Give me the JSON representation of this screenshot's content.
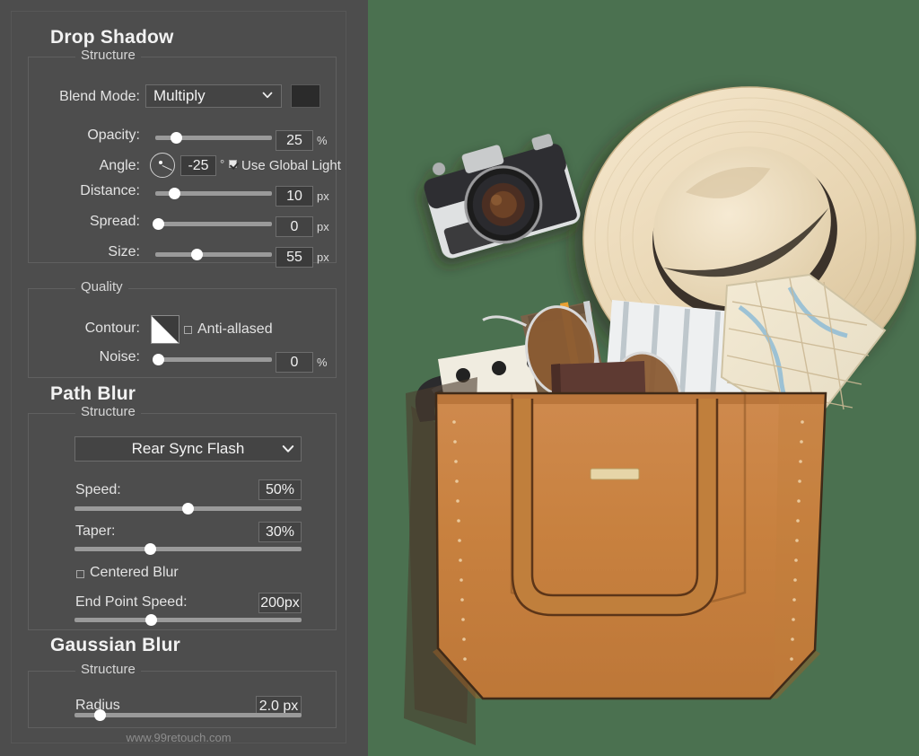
{
  "panel": {
    "watermark": "www.99retouch.com",
    "sections": [
      {
        "title": "Drop Shadow",
        "groups": [
          {
            "legend": "Structure",
            "rows": [
              {
                "label": "Blend Mode:",
                "control": "dropdown",
                "value": "Multiply",
                "swatch_color": "#2b2b2b"
              },
              {
                "label": "Opacity:",
                "control": "slider",
                "value": "25",
                "unit": "%",
                "fill": 18
              },
              {
                "label": "Angle:",
                "control": "dial",
                "value": "-25",
                "unit": "°",
                "checkbox": {
                  "label": "Use Global Light",
                  "checked": true
                }
              },
              {
                "label": "Distance:",
                "control": "slider",
                "value": "10",
                "unit": "px",
                "fill": 17
              },
              {
                "label": "Spread:",
                "control": "slider",
                "value": "0",
                "unit": "px",
                "fill": 0
              },
              {
                "label": "Size:",
                "control": "slider",
                "value": "55",
                "unit": "px",
                "fill": 35
              }
            ]
          },
          {
            "legend": "Quality",
            "rows": [
              {
                "label": "Contour:",
                "control": "contour",
                "checkbox": {
                  "label": "Anti-allased",
                  "checked": false
                }
              },
              {
                "label": "Noise:",
                "control": "slider",
                "value": "0",
                "unit": "%",
                "fill": 0
              }
            ]
          }
        ]
      },
      {
        "title": "Path Blur",
        "groups": [
          {
            "legend": "Structure",
            "rows": [
              {
                "control": "dropdown-wide",
                "value": "Rear Sync Flash"
              },
              {
                "label": "Speed:",
                "control": "slider-below",
                "value": "50%",
                "fill": 50
              },
              {
                "label": "Taper:",
                "control": "slider-below",
                "value": "30%",
                "fill": 30
              },
              {
                "control": "checkbox-row",
                "checkbox": {
                  "label": "Centered Blur",
                  "checked": false
                }
              },
              {
                "label": "End Point Speed:",
                "control": "slider-below",
                "value": "200px",
                "fill": 32
              }
            ]
          }
        ]
      },
      {
        "title": "Gaussian Blur",
        "groups": [
          {
            "legend": "Structure",
            "rows": [
              {
                "label": "Radius",
                "control": "slider-below",
                "value": "2.0 px",
                "fill": 11
              }
            ]
          }
        ]
      }
    ]
  },
  "photo": {
    "alt": "Flat-lay of a tan leather tote bag filled with travel items, a straw fedora hat, a vintage film camera, sunglasses, notebooks, a map, an umbrella and a passport on a green background",
    "background_color": "#4b7150",
    "items": [
      "tote-bag",
      "straw-hat",
      "film-camera",
      "sunglasses",
      "map",
      "notebook",
      "passport",
      "umbrella",
      "pencil",
      "polka-dot-pouch"
    ]
  },
  "colors": {
    "panel_bg": "#4d4d4d",
    "group_border": "#606060",
    "text": "#e3e3e3",
    "title": "#f2f2f2",
    "slider_track": "#9a9a9a",
    "slider_thumb": "#ffffff",
    "field_bg": "#434343",
    "accent_green": "#4b7150"
  }
}
